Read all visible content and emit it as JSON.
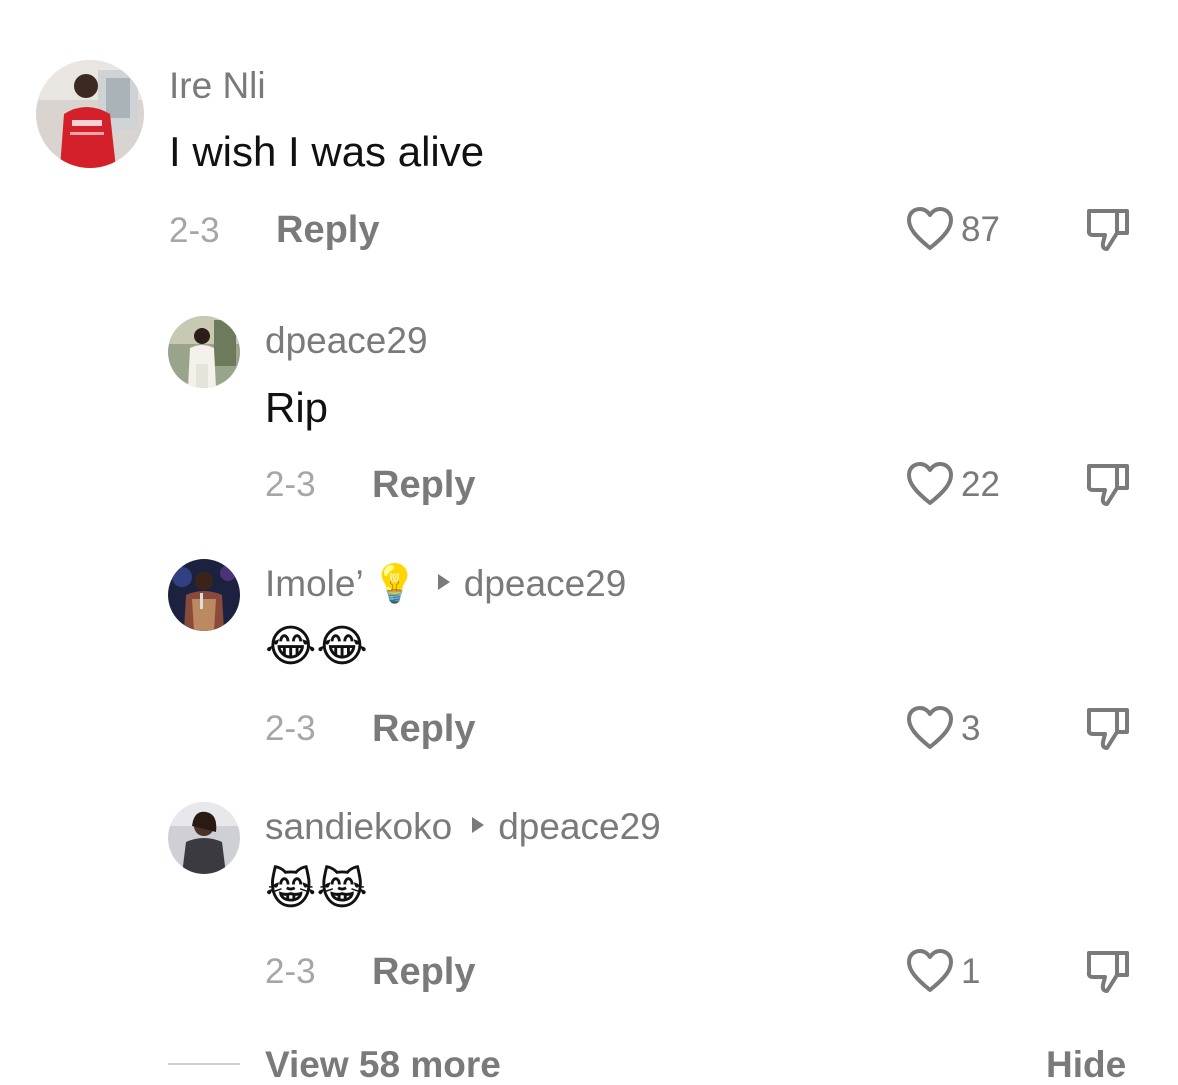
{
  "comments": [
    {
      "username": "Ire Nli",
      "text": "I wish I was alive",
      "date": "2-3",
      "reply_label": "Reply",
      "likes": "87"
    },
    {
      "username": "dpeace29",
      "text": "Rip",
      "date": "2-3",
      "reply_label": "Reply",
      "likes": "22"
    },
    {
      "username": "Imole’",
      "username_emoji": "💡",
      "reply_to": "dpeace29",
      "text": "😂😂",
      "date": "2-3",
      "reply_label": "Reply",
      "likes": "3"
    },
    {
      "username": "sandiekoko",
      "reply_to": "dpeace29",
      "text": "😹😹",
      "date": "2-3",
      "reply_label": "Reply",
      "likes": "1"
    }
  ],
  "footer": {
    "view_more_label": "View 58 more",
    "hide_label": "Hide"
  },
  "icons": {
    "like": "heart-outline-icon",
    "dislike": "thumbs-down-outline-icon",
    "reply_to": "triangle-right-icon"
  },
  "colors": {
    "username": "#7a7a7a",
    "text": "#111111",
    "date": "#a6a6a6",
    "icon": "#7a7a7a"
  }
}
